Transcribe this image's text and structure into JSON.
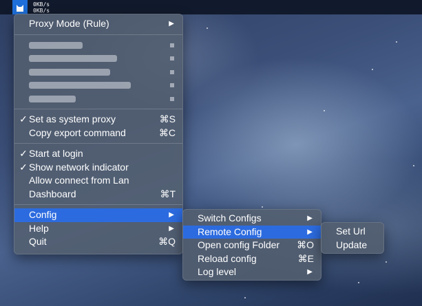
{
  "menubar": {
    "upload_speed": "0KB/s",
    "download_speed": "0KB/s",
    "icon": "cat-icon"
  },
  "main_menu": {
    "proxy_mode": "Proxy Mode (Rule)",
    "set_system_proxy": "Set as system proxy",
    "set_system_proxy_shortcut": "⌘S",
    "copy_export": "Copy export command",
    "copy_export_shortcut": "⌘C",
    "start_at_login": "Start at login",
    "show_network_indicator": "Show network indicator",
    "allow_lan": "Allow connect from Lan",
    "dashboard": "Dashboard",
    "dashboard_shortcut": "⌘T",
    "config": "Config",
    "help": "Help",
    "quit": "Quit",
    "quit_shortcut": "⌘Q",
    "checkmark": "✓",
    "submenu_arrow": "▶"
  },
  "config_menu": {
    "switch_configs": "Switch Configs",
    "remote_config": "Remote Config",
    "open_folder": "Open config Folder",
    "open_folder_shortcut": "⌘O",
    "reload_config": "Reload config",
    "reload_config_shortcut": "⌘E",
    "log_level": "Log level"
  },
  "remote_menu": {
    "set_url": "Set Url",
    "update": "Update"
  },
  "colors": {
    "highlight": "#2c6bdf",
    "menubar": "#111a2c",
    "tray_icon_bg": "#1e6fd9"
  }
}
